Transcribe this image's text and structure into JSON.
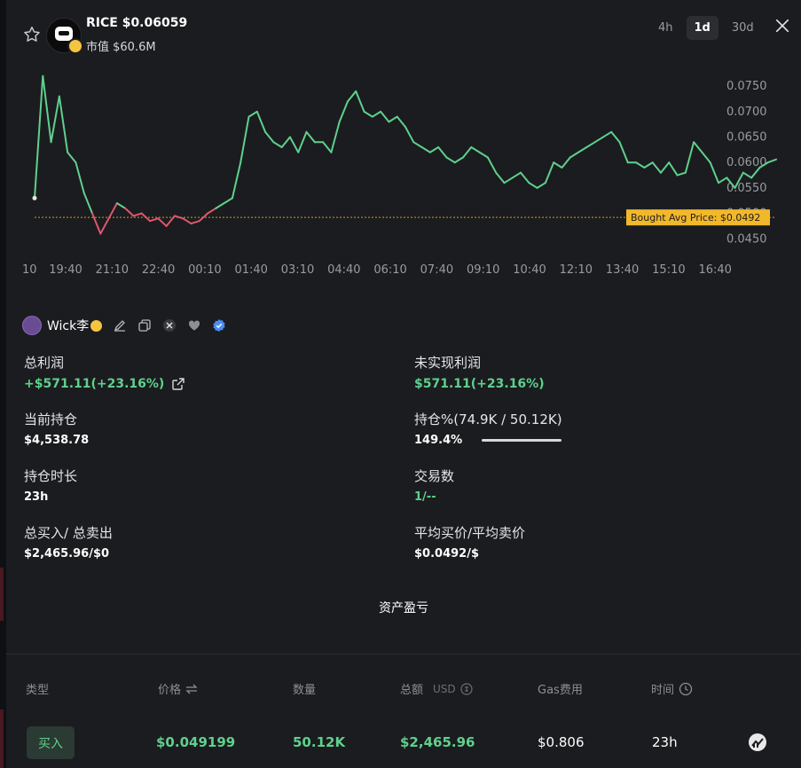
{
  "header": {
    "token": "RICE",
    "price": "$0.06059",
    "market_cap": "市值 $60.6M",
    "timeframes": [
      "4h",
      "1d",
      "30d"
    ],
    "active_timeframe": "1d"
  },
  "chart_data": {
    "type": "line",
    "x_ticks": [
      "10",
      "19:40",
      "21:10",
      "22:40",
      "00:10",
      "01:40",
      "03:10",
      "04:40",
      "06:10",
      "07:40",
      "09:10",
      "10:40",
      "12:10",
      "13:40",
      "15:10",
      "16:40"
    ],
    "y_ticks": [
      "0.0750",
      "0.0700",
      "0.0650",
      "0.0600",
      "0.0550",
      "0.0500",
      "0.0450"
    ],
    "ylim": [
      0.044,
      0.078
    ],
    "avg_price_label": "Bought Avg Price: $0.0492",
    "avg_price": 0.0492,
    "colors": {
      "up": "#5fd08d",
      "down": "#e0566e",
      "avg_line": "#c9a227"
    },
    "x_values": [
      0.0,
      0.2,
      0.4,
      0.6,
      0.8,
      1.0,
      1.2,
      1.4,
      1.6,
      1.8,
      2.0,
      2.2,
      2.4,
      2.6,
      2.8,
      3.0,
      3.2,
      3.4,
      3.6,
      3.8,
      4.0,
      4.2,
      4.4,
      4.6,
      4.8,
      5.0,
      5.2,
      5.4,
      5.6,
      5.8,
      6.0,
      6.2,
      6.4,
      6.6,
      6.8,
      7.0,
      7.2,
      7.4,
      7.6,
      7.8,
      8.0,
      8.2,
      8.4,
      8.6,
      8.8,
      9.0,
      9.2,
      9.4,
      9.6,
      9.8,
      10.0,
      10.2,
      10.4,
      10.6,
      10.8,
      11.0,
      11.2,
      11.4,
      11.6,
      11.8,
      12.0,
      12.2,
      12.4,
      12.6,
      12.8,
      13.0,
      13.2,
      13.4,
      13.6,
      13.8,
      14.0,
      14.2,
      14.4,
      14.6,
      14.8,
      15.0,
      15.2,
      15.4,
      15.6,
      15.8,
      16.0,
      16.2,
      16.4,
      16.6,
      16.8,
      17.0,
      17.2,
      17.4,
      17.6,
      17.8,
      18.0
    ],
    "values": [
      0.053,
      0.077,
      0.064,
      0.073,
      0.062,
      0.06,
      0.054,
      0.05,
      0.046,
      0.049,
      0.052,
      0.051,
      0.0495,
      0.05,
      0.0485,
      0.049,
      0.0475,
      0.0495,
      0.049,
      0.048,
      0.0485,
      0.05,
      0.051,
      0.052,
      0.053,
      0.06,
      0.069,
      0.07,
      0.066,
      0.064,
      0.063,
      0.065,
      0.062,
      0.066,
      0.064,
      0.064,
      0.062,
      0.068,
      0.072,
      0.074,
      0.07,
      0.069,
      0.07,
      0.068,
      0.069,
      0.067,
      0.064,
      0.063,
      0.062,
      0.063,
      0.061,
      0.06,
      0.061,
      0.063,
      0.062,
      0.061,
      0.058,
      0.056,
      0.057,
      0.058,
      0.056,
      0.055,
      0.056,
      0.06,
      0.059,
      0.061,
      0.062,
      0.063,
      0.064,
      0.065,
      0.066,
      0.064,
      0.06,
      0.06,
      0.059,
      0.06,
      0.058,
      0.06,
      0.0575,
      0.058,
      0.064,
      0.062,
      0.06,
      0.056,
      0.057,
      0.055,
      0.058,
      0.057,
      0.059,
      0.06,
      0.0606
    ]
  },
  "trader": {
    "name": "Wick李"
  },
  "stats": {
    "total_pnl_label": "总利润",
    "total_pnl_value": "+$571.11(+23.16%)",
    "unrealized_label": "未实现利润",
    "unrealized_value": "$571.11(+23.16%)",
    "position_label": "当前持仓",
    "position_value": "$4,538.78",
    "holding_pct_label": "持仓%(74.9K / 50.12K)",
    "holding_pct_value": "149.4%",
    "holding_pct_fill": 1.0,
    "duration_label": "持仓时长",
    "duration_value": "23h",
    "trades_label": "交易数",
    "trades_value": "1/--",
    "buy_sell_label": "总买入/ 总卖出",
    "buy_sell_value": "$2,465.96/$0",
    "avg_price_label": "平均买价/平均卖价",
    "avg_price_value": "$0.0492/$"
  },
  "section_title": "资产盈亏",
  "table": {
    "headers": {
      "type": "类型",
      "price": "价格",
      "amount": "数量",
      "total": "总额",
      "total_unit": "USD",
      "gas": "Gas费用",
      "time": "时间"
    },
    "rows": [
      {
        "type": "买入",
        "price": "$0.049199",
        "amount": "50.12K",
        "total": "$2,465.96",
        "gas": "$0.806",
        "time": "23h"
      }
    ]
  }
}
